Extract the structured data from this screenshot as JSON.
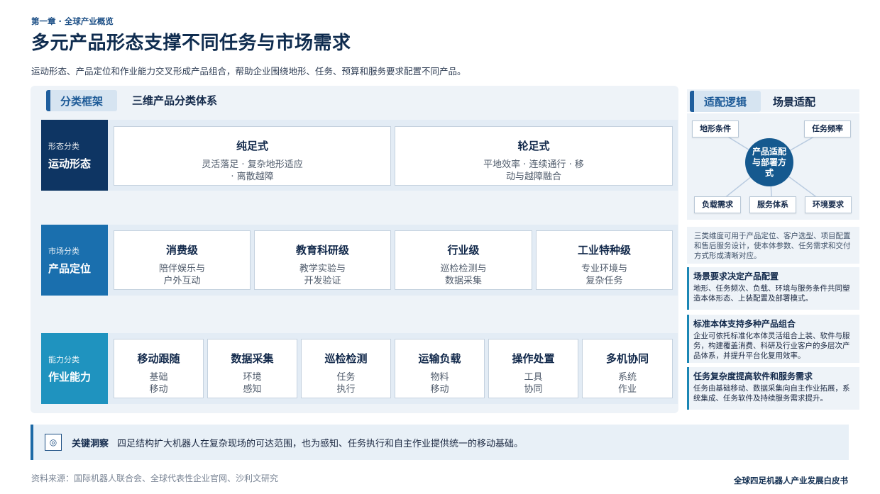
{
  "header": {
    "chapter": "第一章 · 全球产业概览",
    "title": "多元产品形态支撑不同任务与市场需求",
    "subtitle": "运动形态、产品定位和作业能力交叉形成产品组合，帮助企业围绕地形、任务、预算和服务要求配置不同产品。"
  },
  "left_panel": {
    "tab": "分类框架",
    "title": "三维产品分类体系",
    "rows": [
      {
        "category": "形态分类",
        "name": "运动形态",
        "cards": [
          {
            "title": "纯足式",
            "desc": "灵活落足 · 复杂地形适应 · 离散越障"
          },
          {
            "title": "轮足式",
            "desc": "平地效率 · 连续通行 · 移动与越障融合"
          }
        ]
      },
      {
        "category": "市场分类",
        "name": "产品定位",
        "cards": [
          {
            "title": "消费级",
            "desc1": "陪伴娱乐与",
            "desc2": "户外互动"
          },
          {
            "title": "教育科研级",
            "desc1": "教学实验与",
            "desc2": "开发验证"
          },
          {
            "title": "行业级",
            "desc1": "巡检检测与",
            "desc2": "数据采集"
          },
          {
            "title": "工业特种级",
            "desc1": "专业环境与",
            "desc2": "复杂任务"
          }
        ]
      },
      {
        "category": "能力分类",
        "name": "作业能力",
        "cards": [
          {
            "title": "移动跟随",
            "desc1": "基础",
            "desc2": "移动"
          },
          {
            "title": "数据采集",
            "desc1": "环境",
            "desc2": "感知"
          },
          {
            "title": "巡检检测",
            "desc1": "任务",
            "desc2": "执行"
          },
          {
            "title": "运输负载",
            "desc1": "物料",
            "desc2": "移动"
          },
          {
            "title": "操作处置",
            "desc1": "工具",
            "desc2": "协同"
          },
          {
            "title": "多机协同",
            "desc1": "系统",
            "desc2": "作业"
          }
        ]
      }
    ]
  },
  "right_panel": {
    "tab": "适配逻辑",
    "title": "场景适配",
    "diagram": {
      "center": "产品适配与部署方式",
      "nodes": [
        "地形条件",
        "任务频率",
        "负载需求",
        "服务体系",
        "环境要求"
      ]
    },
    "note": "三类维度可用于产品定位、客户选型、项目配置和售后服务设计，使本体参数、任务需求和交付方式形成清晰对应。",
    "cards": [
      {
        "title": "场景要求决定产品配置",
        "desc": "地形、任务频次、负载、环境与服务条件共同塑造本体形态、上装配置及部署模式。"
      },
      {
        "title": "标准本体支持多种产品组合",
        "desc": "企业可依托标准化本体灵活组合上装、软件与服务，构建覆盖消费、科研及行业客户的多层次产品体系，并提升平台化复用效率。"
      },
      {
        "title": "任务复杂度提高软件和服务需求",
        "desc": "任务由基础移动、数据采集向自主作业拓展，系统集成、任务软件及持续服务需求提升。"
      }
    ]
  },
  "insight": {
    "icon": "target-icon",
    "label": "关键洞察",
    "text": "四足结构扩大机器人在复杂现场的可达范围，也为感知、任务执行和自主作业提供统一的移动基础。"
  },
  "footer": {
    "source": "资料来源：国际机器人联合会、全球代表性企业官网、沙利文研究",
    "brand": "全球四足机器人产业发展白皮书"
  },
  "colors": {
    "row1": "#0e3563",
    "row2": "#1a6fae",
    "row3": "#1f93bf",
    "accent": "#1f5e9d"
  }
}
